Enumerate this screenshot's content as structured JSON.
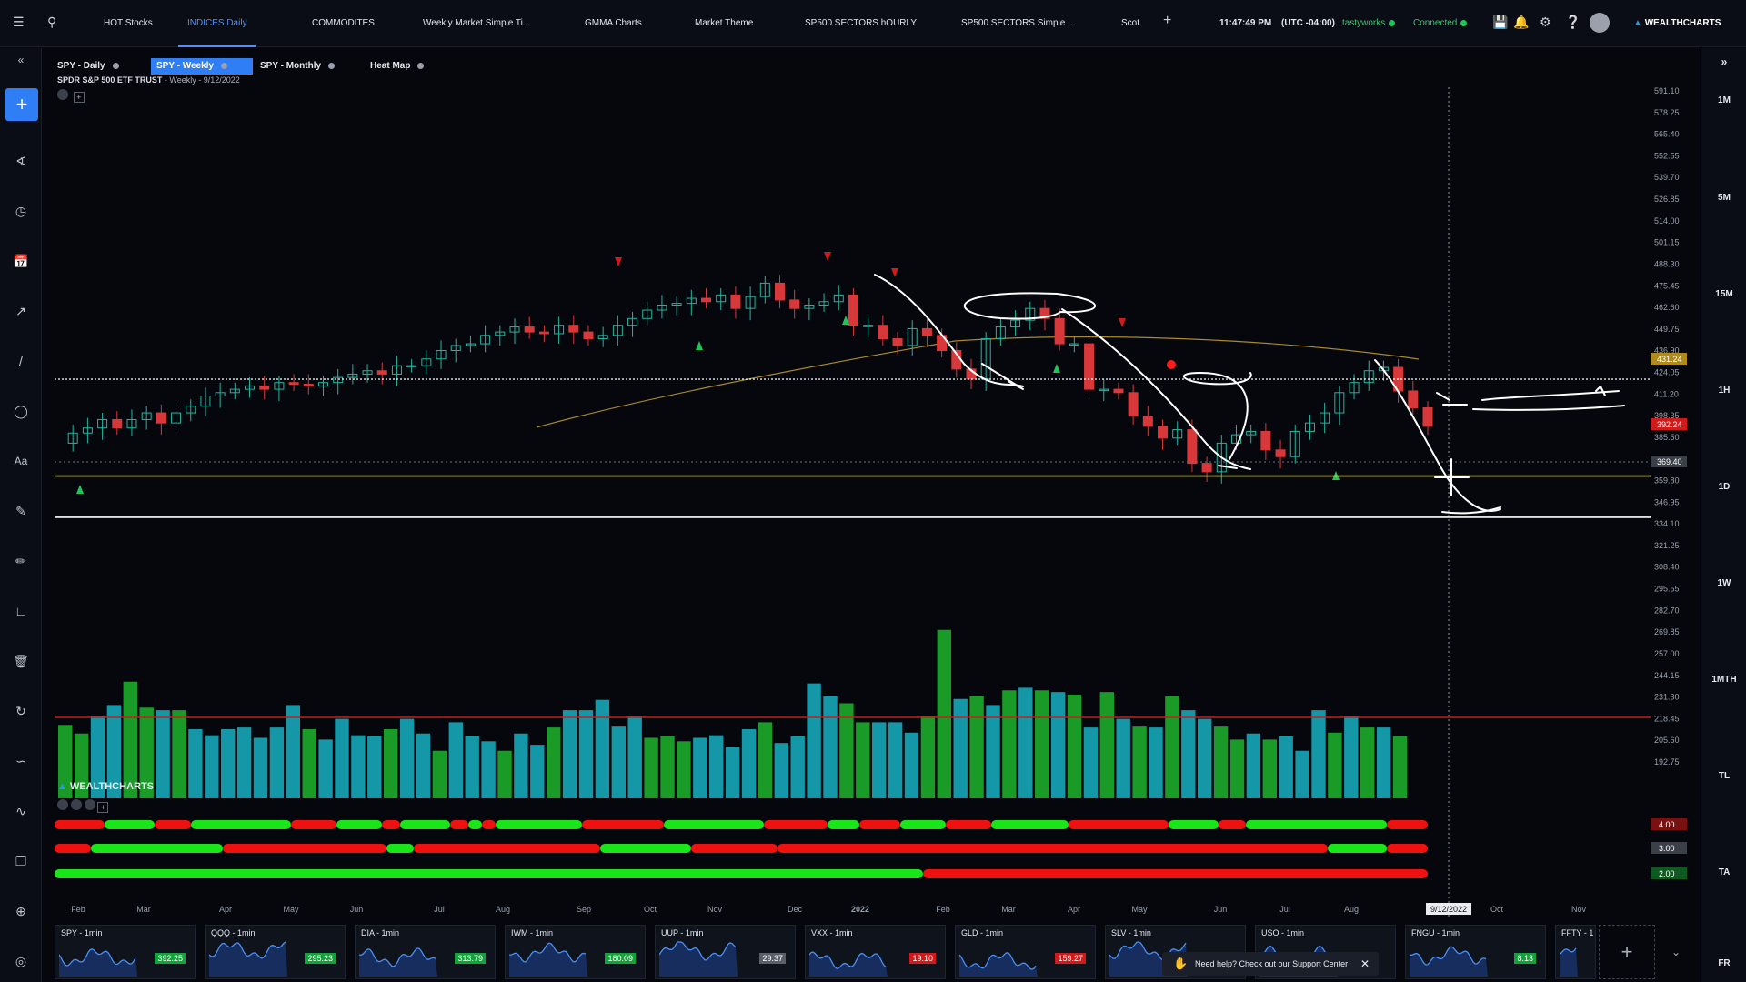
{
  "topbar": {
    "tabs": [
      "HOT Stocks",
      "INDICES Daily",
      "COMMODITES",
      "Weekly Market Simple Ti...",
      "GMMA Charts",
      "Market Theme",
      "SP500 SECTORS hOURLY",
      "SP500 SECTORS Simple ...",
      "Scot"
    ],
    "active_tab": "INDICES Daily",
    "time": "11:47:49 PM",
    "timezone": "(UTC -04:00)",
    "broker": "tastyworks",
    "connection": "Connected",
    "brand": "WEALTHCHARTS"
  },
  "chart_tabs": [
    "SPY - Daily",
    "SPY - Weekly",
    "SPY - Monthly",
    "Heat Map"
  ],
  "active_chart_tab": "SPY - Weekly",
  "chart_title": {
    "name": "SPDR S&P 500 ETF TRUST",
    "detail": " - Weekly - 9/12/2022"
  },
  "right_timeframes": [
    "1M",
    "5M",
    "15M",
    "1H",
    "1D",
    "1W",
    "1MTH",
    "TL",
    "TA",
    "FR"
  ],
  "watermark": "WEALTHCHARTS",
  "chart_data": {
    "type": "candlestick",
    "interval": "weekly",
    "ylim": [
      180,
      600
    ],
    "price_ticks": [
      "591.10",
      "578.25",
      "565.40",
      "552.55",
      "539.70",
      "526.85",
      "514.00",
      "501.15",
      "488.30",
      "475.45",
      "462.60",
      "449.75",
      "436.90",
      "424.05",
      "411.20",
      "398.35",
      "385.50",
      "372.65",
      "359.80",
      "346.95",
      "334.10",
      "321.25",
      "308.40",
      "295.55",
      "282.70",
      "269.85",
      "257.00",
      "244.15",
      "231.30",
      "218.45",
      "205.60",
      "192.75"
    ],
    "price_labels": [
      {
        "text": "431.24",
        "color": "#b08a1a"
      },
      {
        "text": "392.24",
        "color": "#d11a1a"
      },
      {
        "text": "369.40",
        "color": "#3a3f48"
      }
    ],
    "x_labels": [
      "Feb",
      "Mar",
      "Apr",
      "May",
      "Jun",
      "Jul",
      "Aug",
      "Sep",
      "Oct",
      "Nov",
      "Dec",
      "2022",
      "Feb",
      "Mar",
      "Apr",
      "May",
      "Jun",
      "Jul",
      "Aug",
      "9/12/2022",
      "Oct",
      "Nov"
    ],
    "horizontal_levels": [
      {
        "price": 420,
        "color": "#ffffff",
        "style": "dotted"
      },
      {
        "price": 362.5,
        "color": "#d9d24a",
        "style": "solid"
      },
      {
        "price": 338,
        "color": "#ffffff",
        "style": "solid"
      }
    ],
    "annotations": {
      "text_written": "B..and st"
    },
    "indicator_values": [
      "4.00",
      "3.00",
      "2.00"
    ]
  },
  "mini_charts": [
    {
      "label": "SPY - 1min",
      "price": "392.25",
      "color": "#12a33a"
    },
    {
      "label": "QQQ - 1min",
      "price": "295.23",
      "color": "#12a33a"
    },
    {
      "label": "DIA - 1min",
      "price": "313.79",
      "color": "#12a33a"
    },
    {
      "label": "IWM - 1min",
      "price": "180.09",
      "color": "#12a33a"
    },
    {
      "label": "UUP - 1min",
      "price": "29.37",
      "color": "#5a5f68"
    },
    {
      "label": "VXX - 1min",
      "price": "19.10",
      "color": "#d11a1a"
    },
    {
      "label": "GLD - 1min",
      "price": "159.27",
      "color": "#d11a1a"
    },
    {
      "label": "SLV - 1min",
      "price": "",
      "color": "#12a33a"
    },
    {
      "label": "USO - 1min",
      "price": "",
      "color": "#12a33a"
    },
    {
      "label": "FNGU - 1min",
      "price": "8.13",
      "color": "#12a33a"
    },
    {
      "label": "FFTY - 1",
      "price": "",
      "color": "#12a33a"
    }
  ],
  "help_text": "Need help? Check out our Support Center"
}
